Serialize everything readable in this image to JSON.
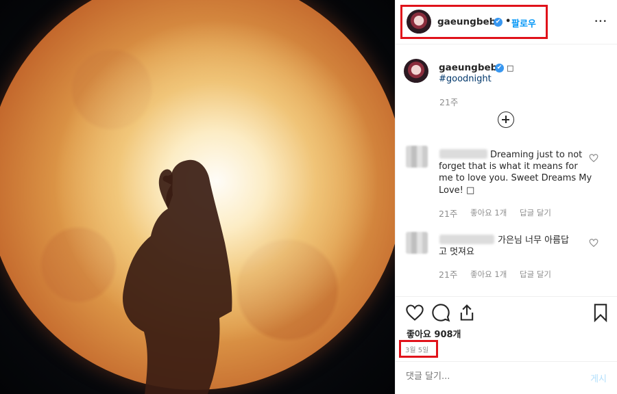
{
  "header": {
    "username": "gaeungbebe",
    "verified_glyph": "✔",
    "separator": "•",
    "follow_label": "팔로우",
    "more_label": "•••"
  },
  "caption": {
    "username": "gaeungbebe",
    "verified_glyph": "✔",
    "box_glyph": "□",
    "hashtag": "#goodnight",
    "time": "21주"
  },
  "load_more_icon": "plus-circle-icon",
  "comments": [
    {
      "line1": "Dreaming just to not",
      "line2": "forget that is what it means for",
      "line3": "me to love you. Sweet Dreams My",
      "line4": "Love! □",
      "time": "21주",
      "likes": "좋아요 1개",
      "reply": "답글 달기"
    },
    {
      "line1": "가은님 너무 아름답",
      "line2": "고 멋져요",
      "time": "21주",
      "likes": "좋아요 1개",
      "reply": "답글 달기"
    }
  ],
  "likes_text": "좋아요 908개",
  "date_text": "3월 5일",
  "add_comment": {
    "placeholder": "댓글 달기...",
    "post_label": "게시"
  },
  "colors": {
    "link_blue": "#0095f6",
    "highlight_red": "#e0121a",
    "muted_gray": "#8e8e8e"
  }
}
